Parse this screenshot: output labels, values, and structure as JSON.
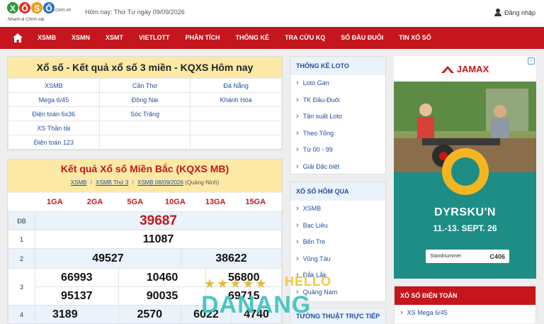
{
  "header": {
    "logo_letters": [
      "X",
      "Ổ",
      "S",
      "Ố"
    ],
    "logo_domain": ".com.vn",
    "logo_tagline": "Nhanh & Chính xác",
    "today_label": "Hôm nay: Thứ Tư ngày 09/09/2026",
    "login_label": "Đăng nhập"
  },
  "nav": {
    "items": [
      "XSMB",
      "XSMN",
      "XSMT",
      "VIETLOTT",
      "PHÂN TÍCH",
      "THỐNG KÊ",
      "TRA CỨU KQ",
      "SỐ ĐẦU ĐUÔI",
      "TIN XỔ SỐ"
    ]
  },
  "quicklinks": {
    "title": "Xổ số - Kết quả xổ số 3 miền - KQXS Hôm nay",
    "rows": [
      [
        "XSMB",
        "Cần Thơ",
        "Đà Nẵng"
      ],
      [
        "Mega 6/45",
        "Đồng Nai",
        "Khánh Hòa"
      ],
      [
        "Điện toán 6x36",
        "Sóc Trăng",
        ""
      ],
      [
        "XS Thần tài",
        "",
        ""
      ],
      [
        "Điện toán 123",
        "",
        ""
      ]
    ]
  },
  "results": {
    "title": "Kết quả Xổ số Miền Bắc (KQXS MB)",
    "breadcrumb": [
      "XSMB",
      "XSMB Thứ 3",
      "XSMB 08/09/2026"
    ],
    "breadcrumb_sep": "/",
    "province": "(Quảng Ninh)",
    "prize_headers": [
      "1GA",
      "2GA",
      "5GA",
      "10GA",
      "13GA",
      "15GA"
    ],
    "special_label": "ĐB",
    "special": "39687",
    "prize1_label": "1",
    "prize1": "11087",
    "prize2_label": "2",
    "prize2": [
      "49527",
      "38622"
    ],
    "prize3_label": "3",
    "prize3": [
      "66993",
      "10460",
      "56800",
      "95137",
      "90035",
      "69715"
    ],
    "prize4_label": "4",
    "prize4": [
      "3189",
      "2570",
      "6022",
      "4740"
    ]
  },
  "sidebar": {
    "loto_title": "THỐNG KÊ LOTO",
    "loto_items": [
      "Loto Gan",
      "TK Đầu-Đuôi",
      "Tần suất Loto",
      "Theo Tổng",
      "Từ 00 - 99",
      "Giải Đặc biệt"
    ],
    "yesterday_title": "XỔ SỐ HÔM QUA",
    "yesterday_items": [
      "XSMB",
      "Bạc Liêu",
      "Bến Tre",
      "Vũng Tàu",
      "Đắk Lắk",
      "Quảng Nam"
    ],
    "live_title": "TƯỜNG THUẬT TRỰC TIẾP"
  },
  "ad": {
    "brand": "JAMAX",
    "event_title": "DYRSKU'N",
    "event_dates": "11.-13. SEPT. 26",
    "stand_label": "Standnummer",
    "stand_number": "C406",
    "choice_icon": "i"
  },
  "dien_toan": {
    "title": "XỔ SỐ ĐIỆN TOÁN",
    "items": [
      "XS Mega 6/45"
    ]
  },
  "watermark": {
    "hello": "HELLO",
    "city": "DANANG",
    "stars": "★★★★★"
  },
  "colors": {
    "brand_red": "#c4161c",
    "title_yellow": "#fde9a6",
    "link_blue": "#1f4f9c",
    "ad_teal": "#1d8d86"
  }
}
